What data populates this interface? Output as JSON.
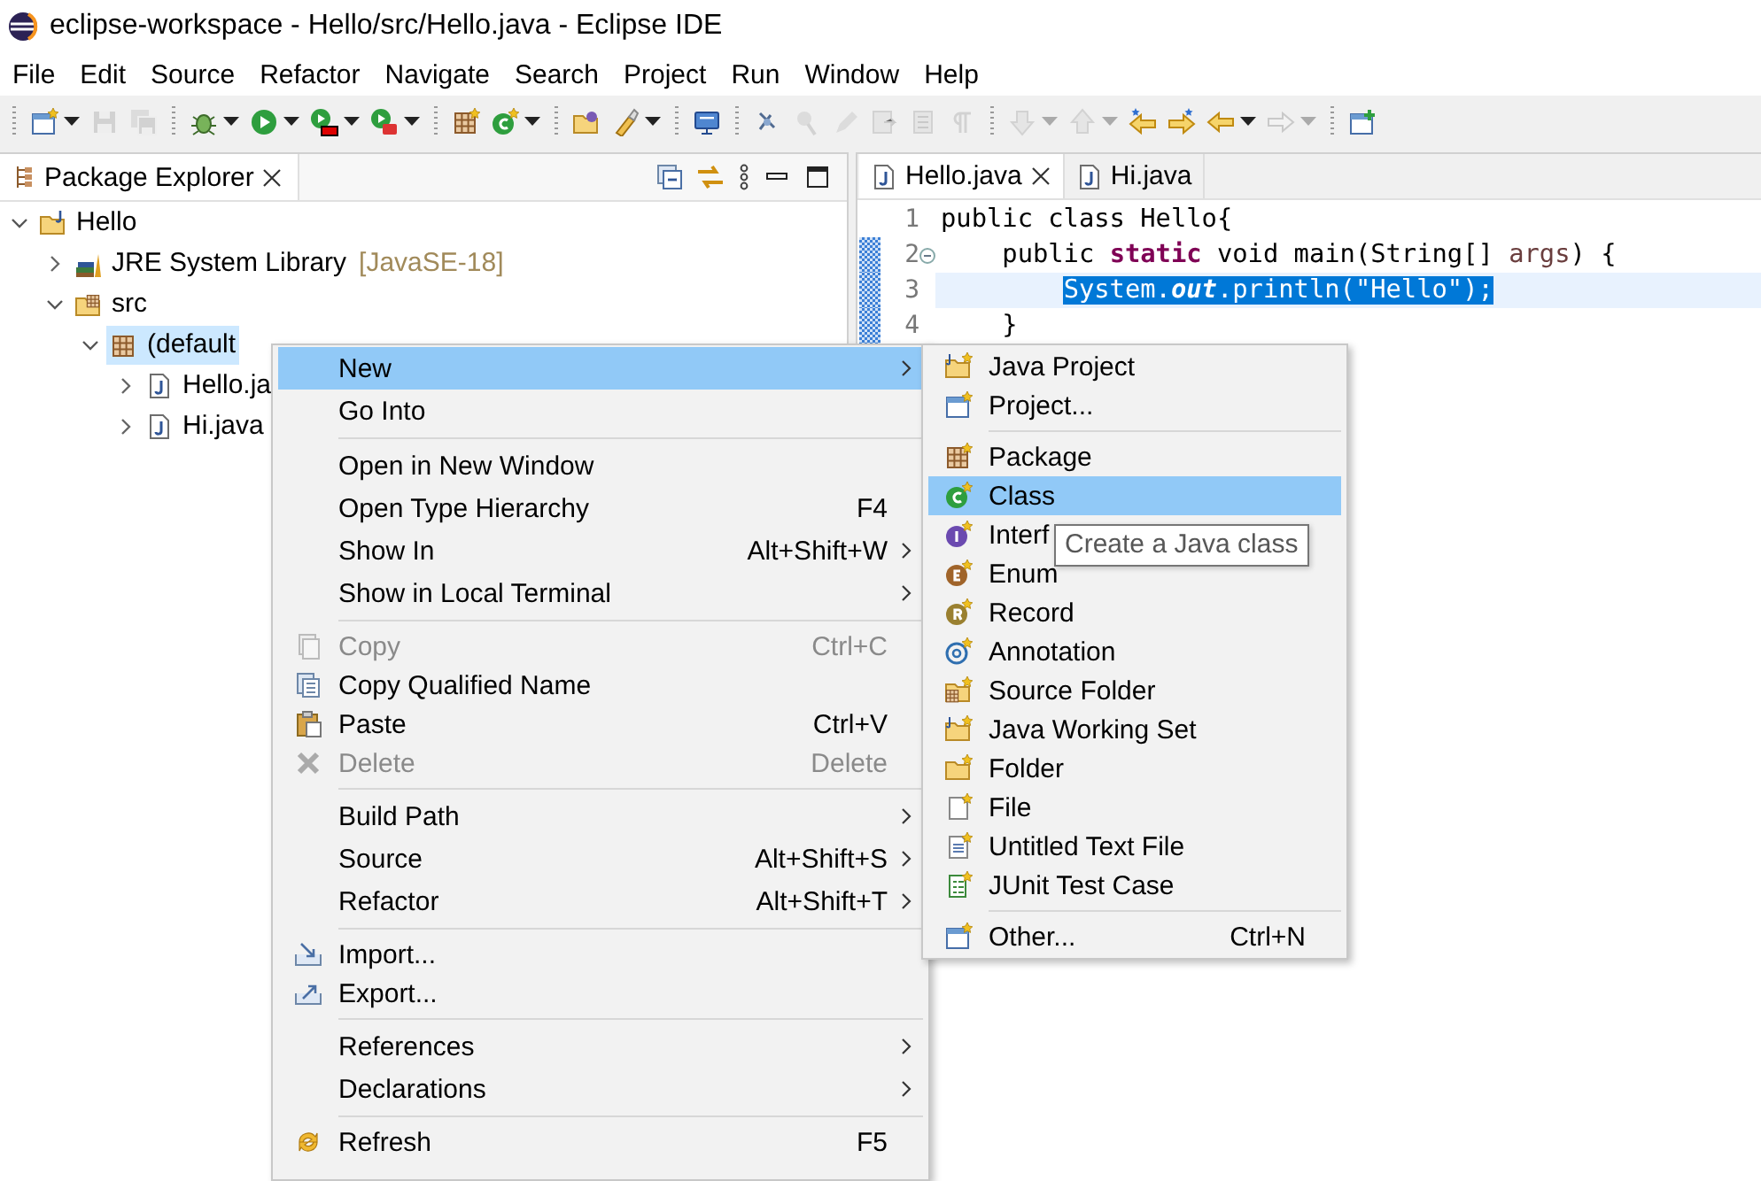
{
  "window": {
    "title": "eclipse-workspace - Hello/src/Hello.java - Eclipse IDE"
  },
  "menu_bar": [
    "File",
    "Edit",
    "Source",
    "Refactor",
    "Navigate",
    "Search",
    "Project",
    "Run",
    "Window",
    "Help"
  ],
  "toolbar": {
    "buttons": [
      {
        "disabled": false,
        "dropdown": true,
        "group_start": true
      },
      {
        "disabled": true,
        "dropdown": false,
        "group_start": false
      },
      {
        "disabled": true,
        "dropdown": false,
        "group_start": false
      },
      {
        "disabled": false,
        "dropdown": true,
        "group_start": true
      },
      {
        "disabled": false,
        "dropdown": true,
        "group_start": false
      },
      {
        "disabled": false,
        "dropdown": true,
        "group_start": false
      },
      {
        "disabled": false,
        "dropdown": true,
        "group_start": false
      },
      {
        "disabled": false,
        "dropdown": false,
        "group_start": true
      },
      {
        "disabled": false,
        "dropdown": true,
        "group_start": false
      },
      {
        "disabled": false,
        "dropdown": false,
        "group_start": true
      },
      {
        "disabled": false,
        "dropdown": true,
        "group_start": false
      },
      {
        "disabled": false,
        "dropdown": false,
        "group_start": true
      },
      {
        "disabled": false,
        "dropdown": false,
        "group_start": true
      },
      {
        "disabled": true,
        "dropdown": false,
        "group_start": false
      },
      {
        "disabled": true,
        "dropdown": false,
        "group_start": false
      },
      {
        "disabled": true,
        "dropdown": false,
        "group_start": false
      },
      {
        "disabled": true,
        "dropdown": false,
        "group_start": false
      },
      {
        "disabled": true,
        "dropdown": false,
        "group_start": false
      },
      {
        "disabled": true,
        "dropdown": true,
        "group_start": true
      },
      {
        "disabled": true,
        "dropdown": true,
        "group_start": false
      },
      {
        "disabled": false,
        "dropdown": false,
        "group_start": false
      },
      {
        "disabled": false,
        "dropdown": false,
        "group_start": false
      },
      {
        "disabled": false,
        "dropdown": true,
        "group_start": false
      },
      {
        "disabled": true,
        "dropdown": true,
        "group_start": false
      },
      {
        "disabled": false,
        "dropdown": false,
        "group_start": true
      }
    ]
  },
  "package_explorer": {
    "title": "Package Explorer",
    "tree": [
      {
        "label": "Hello",
        "kind": "project",
        "expanded": true,
        "selected": false,
        "children": [
          {
            "label": "JRE System Library",
            "decoration": "[JavaSE-18]",
            "kind": "library",
            "expanded": false,
            "selected": false
          },
          {
            "label": "src",
            "kind": "source-folder",
            "expanded": true,
            "selected": false,
            "children": [
              {
                "label": "(default",
                "kind": "package",
                "expanded": true,
                "selected": true,
                "children": [
                  {
                    "label": "Hello.ja",
                    "kind": "java-file",
                    "expanded": false,
                    "selected": false
                  },
                  {
                    "label": "Hi.java",
                    "kind": "java-file",
                    "expanded": false,
                    "selected": false
                  }
                ]
              }
            ]
          }
        ]
      }
    ]
  },
  "editor": {
    "tabs": [
      {
        "label": "Hello.java",
        "selected": true
      },
      {
        "label": "Hi.java",
        "selected": false
      }
    ],
    "lines": [
      {
        "number": "1",
        "changed": false,
        "foldable": false,
        "current": false,
        "tokens": [
          {
            "text": "public class Hello{",
            "kind": "plain",
            "selected": false
          }
        ]
      },
      {
        "number": "2",
        "changed": true,
        "foldable": true,
        "current": false,
        "tokens": [
          {
            "text": "    public ",
            "kind": "plain",
            "selected": false
          },
          {
            "text": "static",
            "kind": "keyword",
            "selected": false
          },
          {
            "text": " void main(String[] ",
            "kind": "plain",
            "selected": false
          },
          {
            "text": "args",
            "kind": "param",
            "selected": false
          },
          {
            "text": ") {",
            "kind": "plain",
            "selected": false
          }
        ]
      },
      {
        "number": "3",
        "changed": true,
        "foldable": false,
        "current": true,
        "tokens": [
          {
            "text": "        System.",
            "kind": "plain",
            "selected": true
          },
          {
            "text": "out",
            "kind": "field",
            "selected": true
          },
          {
            "text": ".println(\"Hello\");",
            "kind": "plain",
            "selected": true
          }
        ]
      },
      {
        "number": "4",
        "changed": true,
        "foldable": false,
        "current": false,
        "tokens": [
          {
            "text": "    }",
            "kind": "plain",
            "selected": false
          }
        ]
      }
    ]
  },
  "context_menu": {
    "groups": [
      [
        {
          "label": "New",
          "submenu": true,
          "selected": true,
          "disabled": false
        },
        {
          "label": "Go Into",
          "submenu": false,
          "selected": false,
          "disabled": false
        }
      ],
      [
        {
          "label": "Open in New Window",
          "submenu": false,
          "selected": false,
          "disabled": false
        },
        {
          "label": "Open Type Hierarchy",
          "shortcut": "F4",
          "submenu": false,
          "selected": false,
          "disabled": false
        },
        {
          "label": "Show In",
          "shortcut": "Alt+Shift+W",
          "submenu": true,
          "selected": false,
          "disabled": false
        },
        {
          "label": "Show in Local Terminal",
          "submenu": true,
          "selected": false,
          "disabled": false
        }
      ],
      [
        {
          "label": "Copy",
          "shortcut": "Ctrl+C",
          "submenu": false,
          "selected": false,
          "disabled": true
        },
        {
          "label": "Copy Qualified Name",
          "submenu": false,
          "selected": false,
          "disabled": false
        },
        {
          "label": "Paste",
          "shortcut": "Ctrl+V",
          "submenu": false,
          "selected": false,
          "disabled": false
        },
        {
          "label": "Delete",
          "shortcut": "Delete",
          "submenu": false,
          "selected": false,
          "disabled": true
        }
      ],
      [
        {
          "label": "Build Path",
          "submenu": true,
          "selected": false,
          "disabled": false
        },
        {
          "label": "Source",
          "shortcut": "Alt+Shift+S",
          "submenu": true,
          "selected": false,
          "disabled": false
        },
        {
          "label": "Refactor",
          "shortcut": "Alt+Shift+T",
          "submenu": true,
          "selected": false,
          "disabled": false
        }
      ],
      [
        {
          "label": "Import...",
          "submenu": false,
          "selected": false,
          "disabled": false
        },
        {
          "label": "Export...",
          "submenu": false,
          "selected": false,
          "disabled": false
        }
      ],
      [
        {
          "label": "References",
          "submenu": true,
          "selected": false,
          "disabled": false
        },
        {
          "label": "Declarations",
          "submenu": true,
          "selected": false,
          "disabled": false
        }
      ],
      [
        {
          "label": "Refresh",
          "shortcut": "F5",
          "submenu": false,
          "selected": false,
          "disabled": false
        }
      ]
    ]
  },
  "submenu": {
    "groups": [
      [
        {
          "label": "Java Project",
          "submenu": false,
          "selected": false,
          "disabled": false
        },
        {
          "label": "Project...",
          "submenu": false,
          "selected": false,
          "disabled": false
        }
      ],
      [
        {
          "label": "Package",
          "submenu": false,
          "selected": false,
          "disabled": false
        },
        {
          "label": "Class",
          "submenu": false,
          "selected": true,
          "disabled": false
        },
        {
          "label": "Interf",
          "submenu": false,
          "selected": false,
          "disabled": false
        },
        {
          "label": "Enum",
          "submenu": false,
          "selected": false,
          "disabled": false
        },
        {
          "label": "Record",
          "submenu": false,
          "selected": false,
          "disabled": false
        },
        {
          "label": "Annotation",
          "submenu": false,
          "selected": false,
          "disabled": false
        },
        {
          "label": "Source Folder",
          "submenu": false,
          "selected": false,
          "disabled": false
        },
        {
          "label": "Java Working Set",
          "submenu": false,
          "selected": false,
          "disabled": false
        },
        {
          "label": "Folder",
          "submenu": false,
          "selected": false,
          "disabled": false
        },
        {
          "label": "File",
          "submenu": false,
          "selected": false,
          "disabled": false
        },
        {
          "label": "Untitled Text File",
          "submenu": false,
          "selected": false,
          "disabled": false
        },
        {
          "label": "JUnit Test Case",
          "submenu": false,
          "selected": false,
          "disabled": false
        }
      ],
      [
        {
          "label": "Other...",
          "shortcut": "Ctrl+N",
          "submenu": false,
          "selected": false,
          "disabled": false
        }
      ]
    ]
  },
  "tooltip": {
    "text": "Create a Java class"
  }
}
